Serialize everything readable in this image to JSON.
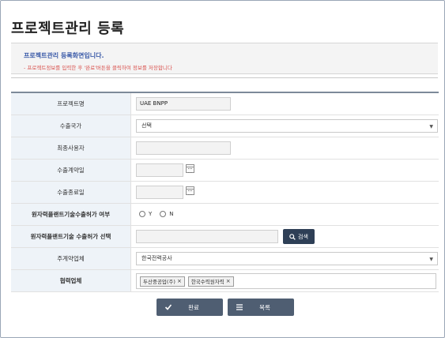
{
  "page": {
    "title": "프로젝트관리 등록",
    "notice_title": "프로젝트관리 등록화면입니다.",
    "notice_text": "- 프로젝트정보를 입력한 후 '완료'버튼을 클릭하여 정보를 저장합니다"
  },
  "form": {
    "rows": [
      {
        "label": "프로젝트명",
        "value": "UAE BNPP"
      },
      {
        "label": "수출국가",
        "value": "선택"
      },
      {
        "label": "최종사용자",
        "value": ""
      },
      {
        "label": "수출계약일",
        "value": ""
      },
      {
        "label": "수출종료일",
        "value": ""
      },
      {
        "label": "원자력플랜트기술수출허가 여부",
        "options": [
          "Y",
          "N"
        ]
      },
      {
        "label": "원자력플랜트기술 수출허가 선택",
        "value": "",
        "button": "검색"
      },
      {
        "label": "주계약업체",
        "value": "한국전력공사"
      },
      {
        "label": "협력업체",
        "tags": [
          "두산중공업(주)",
          "한국수력원자력"
        ]
      }
    ]
  },
  "buttons": {
    "complete": "완료",
    "list": "목록"
  },
  "icons": {
    "calendar": "calendar-icon",
    "search": "search-icon",
    "check": "check-icon",
    "list": "list-icon",
    "close": "close-icon",
    "caret": "caret-down-icon"
  }
}
